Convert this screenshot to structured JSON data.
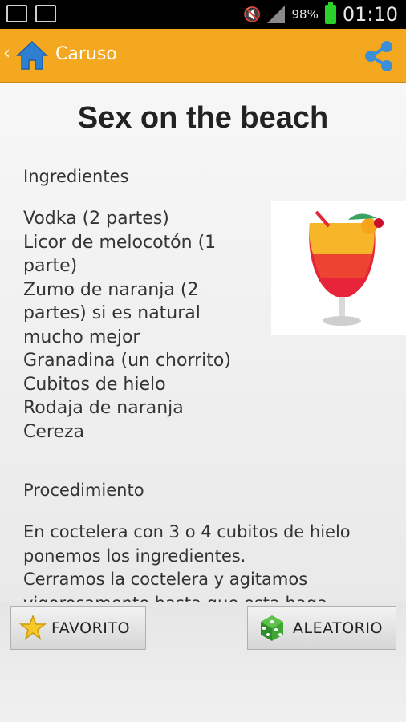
{
  "status_bar": {
    "battery": "98%",
    "time": "01:10"
  },
  "app_bar": {
    "title": "Caruso"
  },
  "recipe": {
    "title": "Sex on the beach",
    "ingredients_heading": "Ingredientes",
    "ingredients": [
      "Vodka (2 partes)",
      "Licor de melocotón (1 parte)",
      "Zumo de naranja (2 partes) si es natural mucho mejor",
      "Granadina (un chorrito)",
      "Cubitos de hielo",
      "Rodaja de naranja",
      "Cereza"
    ],
    "procedure_heading": "Procedimiento",
    "procedure_lines": [
      "En coctelera con 3 o 4 cubitos de hielo ponemos los ingredientes.",
      "Cerramos la coctelera y agitamos vigorosamente hasta que esta haga"
    ]
  },
  "buttons": {
    "favorite": "FAVORITO",
    "random": "ALEATORIO"
  },
  "colors": {
    "app_bar": "#f4a81f",
    "share_icon": "#3a8fd8"
  }
}
